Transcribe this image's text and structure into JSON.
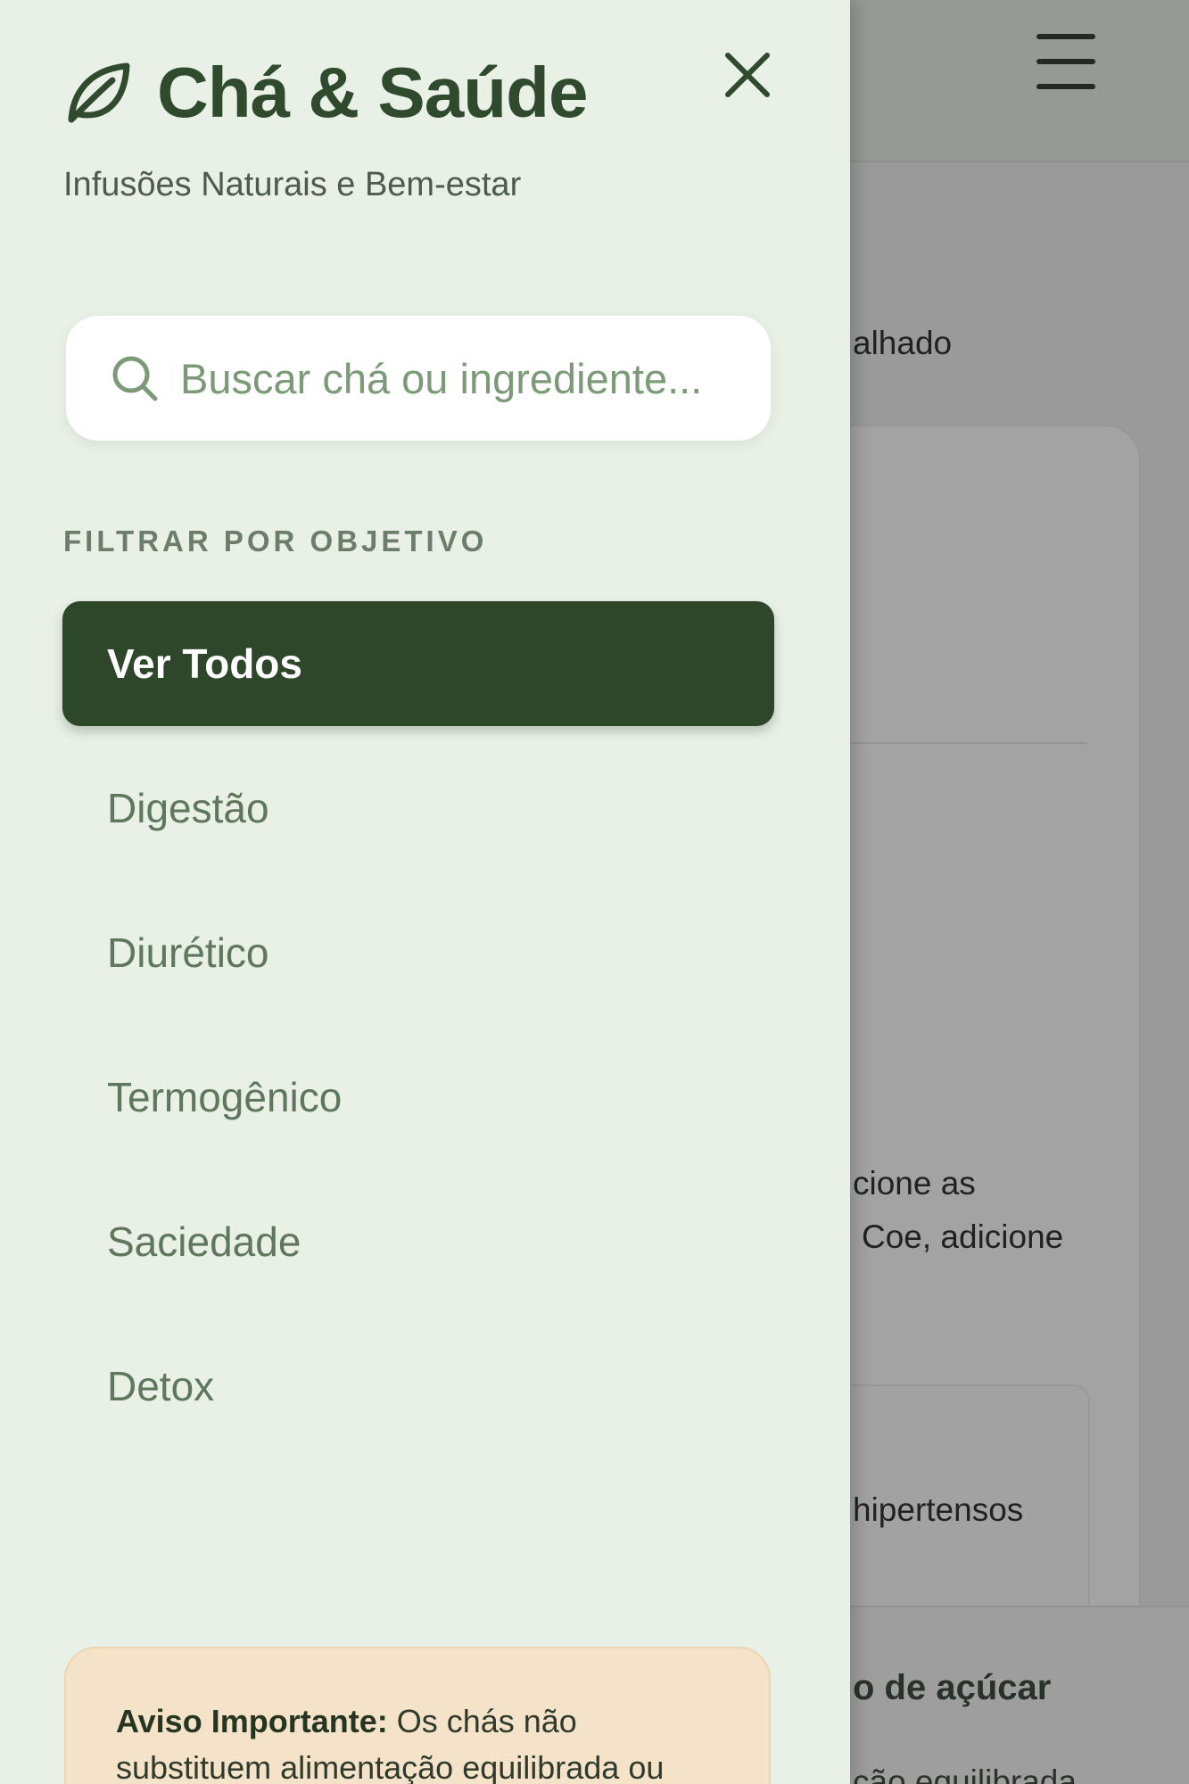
{
  "brand": {
    "title": "Chá & Saúde",
    "subtitle": "Infusões Naturais e Bem-estar",
    "accent_color": "#2e4629",
    "icon": "leaf-icon"
  },
  "search": {
    "placeholder": "Buscar chá ou ingrediente...",
    "value": ""
  },
  "filters": {
    "section_label": "FILTRAR POR OBJETIVO",
    "items": [
      {
        "label": "Ver Todos",
        "active": true
      },
      {
        "label": "Digestão",
        "active": false
      },
      {
        "label": "Diurético",
        "active": false
      },
      {
        "label": "Termogênico",
        "active": false
      },
      {
        "label": "Saciedade",
        "active": false
      },
      {
        "label": "Detox",
        "active": false
      }
    ]
  },
  "notice": {
    "title": "Aviso Importante:",
    "text": "Os chás não substituem alimentação equilibrada ou"
  },
  "background": {
    "fragments": [
      "alhado",
      "cione as",
      "Coe, adicione",
      "hipertensos"
    ],
    "footer_title": "o de açúcar",
    "footer_sub": "ção equilibrada"
  }
}
